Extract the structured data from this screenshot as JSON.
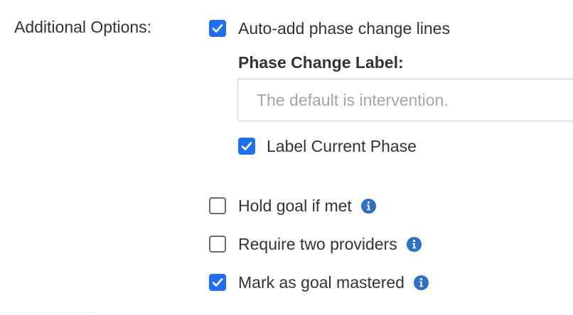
{
  "additional_options": {
    "label": "Additional Options:"
  },
  "auto_add": {
    "label": "Auto-add phase change lines",
    "checked": true
  },
  "phase_change": {
    "heading": "Phase Change Label:",
    "placeholder": "The default is intervention.",
    "value": ""
  },
  "label_current_phase": {
    "label": "Label Current Phase",
    "checked": true
  },
  "hold_goal": {
    "label": "Hold goal if met",
    "checked": false,
    "icon": "info-icon"
  },
  "require_two": {
    "label": "Require two providers",
    "checked": false,
    "icon": "info-icon"
  },
  "mastered": {
    "label": "Mark as goal mastered",
    "checked": true,
    "icon": "info-icon"
  },
  "colors": {
    "checkbox_checked": "#1f6ff0",
    "info_icon": "#2f6fc4",
    "text": "#333333",
    "placeholder": "#a5a5a5"
  }
}
